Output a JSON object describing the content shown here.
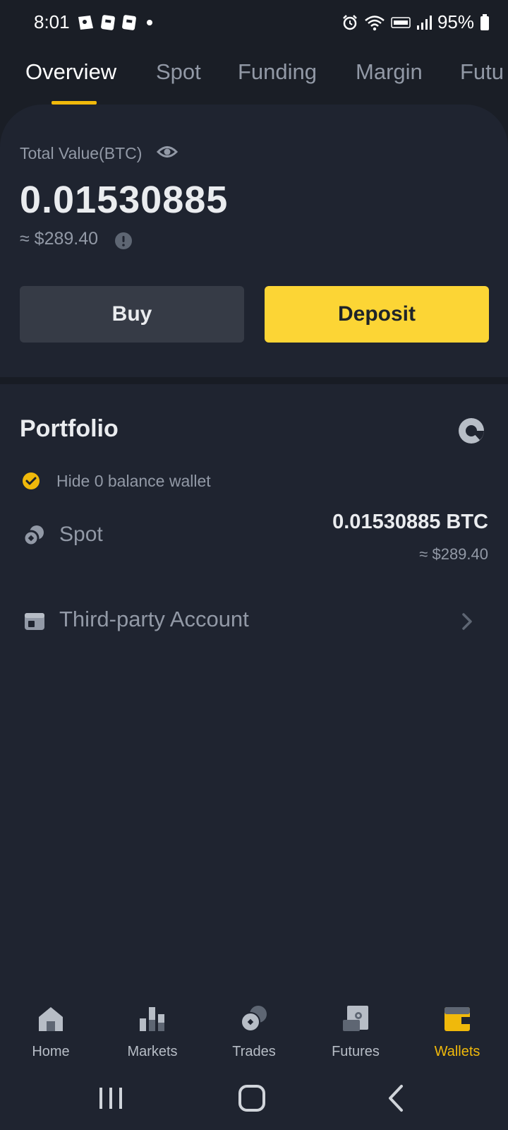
{
  "status_bar": {
    "time": "8:01",
    "battery": "95%",
    "icons": [
      "notification-icon",
      "notification-icon",
      "notification-icon",
      "alarm-icon",
      "wifi-icon",
      "volte-icon",
      "signal-icon",
      "battery-icon"
    ]
  },
  "tabs": [
    {
      "label": "Overview",
      "active": true
    },
    {
      "label": "Spot",
      "active": false
    },
    {
      "label": "Funding",
      "active": false
    },
    {
      "label": "Margin",
      "active": false
    },
    {
      "label": "Futu",
      "active": false
    }
  ],
  "overview": {
    "total_label": "Total Value(BTC)",
    "total_value": "0.01530885",
    "usd_value": "≈ $289.40",
    "buy_label": "Buy",
    "deposit_label": "Deposit"
  },
  "portfolio": {
    "title": "Portfolio",
    "hide_zero_label": "Hide 0 balance wallet",
    "hide_zero_checked": true,
    "accounts": [
      {
        "name": "Spot",
        "btc": "0.01530885 BTC",
        "usd": "≈ $289.40"
      },
      {
        "name": "Third-party Account"
      }
    ]
  },
  "bottom_nav": [
    {
      "label": "Home",
      "icon": "home-icon",
      "active": false
    },
    {
      "label": "Markets",
      "icon": "markets-icon",
      "active": false
    },
    {
      "label": "Trades",
      "icon": "trades-icon",
      "active": false
    },
    {
      "label": "Futures",
      "icon": "futures-icon",
      "active": false
    },
    {
      "label": "Wallets",
      "icon": "wallets-icon",
      "active": true
    }
  ],
  "colors": {
    "accent": "#f0b90b",
    "deposit_bg": "#fcd535",
    "background": "#1f2430",
    "text_secondary": "#9299a6"
  }
}
